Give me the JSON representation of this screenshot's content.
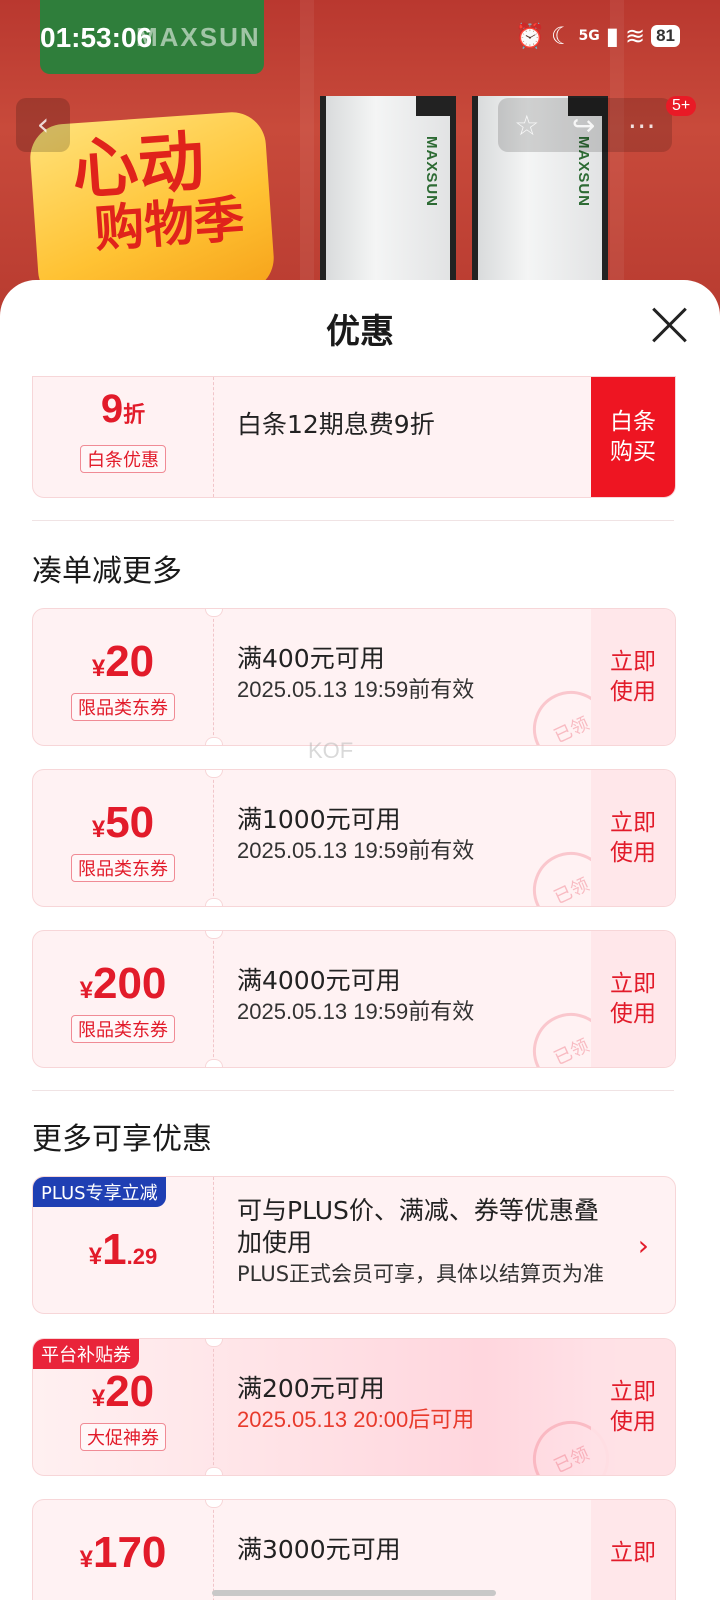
{
  "status_bar": {
    "time": "01:53:06",
    "battery": "81",
    "network": "5G"
  },
  "backdrop": {
    "brand_badge": "MAXSUN",
    "promo_line1": "心动",
    "promo_line2": "购物季",
    "ram_brand": "MAXSUN",
    "cart_badge": "5+"
  },
  "sheet": {
    "title": "优惠"
  },
  "baitiao": {
    "amount": "9",
    "unit": "折",
    "tag": "白条优惠",
    "description": "白条12期息费9折",
    "action": "白条\n购买"
  },
  "section_bundle": {
    "title": "凑单减更多"
  },
  "coupons": [
    {
      "currency": "¥",
      "amount": "20",
      "tag": "限品类东券",
      "condition": "满400元可用",
      "validity": "2025.05.13 19:59前有效",
      "action": "立即\n使用",
      "stamp": "已领"
    },
    {
      "currency": "¥",
      "amount": "50",
      "tag": "限品类东券",
      "condition": "满1000元可用",
      "validity": "2025.05.13 19:59前有效",
      "action": "立即\n使用",
      "stamp": "已领"
    },
    {
      "currency": "¥",
      "amount": "200",
      "tag": "限品类东券",
      "condition": "满4000元可用",
      "validity": "2025.05.13 19:59前有效",
      "action": "立即\n使用",
      "stamp": "已领"
    }
  ],
  "watermark": "KOF",
  "section_more": {
    "title": "更多可享优惠"
  },
  "plus_offer": {
    "corner_tag": "PLUS专享立减",
    "currency": "¥",
    "amount": "1",
    "decimal": ".29",
    "line1": "可与PLUS价、满减、券等优惠叠加使用",
    "line2": "PLUS正式会员可享，具体以结算页为准"
  },
  "platform_offer": {
    "corner_tag": "平台补贴券",
    "currency": "¥",
    "amount": "20",
    "tag": "大促神券",
    "condition": "满200元可用",
    "validity": "2025.05.13 20:00后可用",
    "action": "立即\n使用",
    "stamp": "已领"
  },
  "last_offer": {
    "currency": "¥",
    "amount": "170",
    "condition": "满3000元可用",
    "action": "立即"
  },
  "colors": {
    "accent": "#e21b2a",
    "sheet_bg": "#ffffff",
    "card_bg": "#fff2f3",
    "plus_blue": "#1f3fb3",
    "platform_red": "#e9243a"
  }
}
